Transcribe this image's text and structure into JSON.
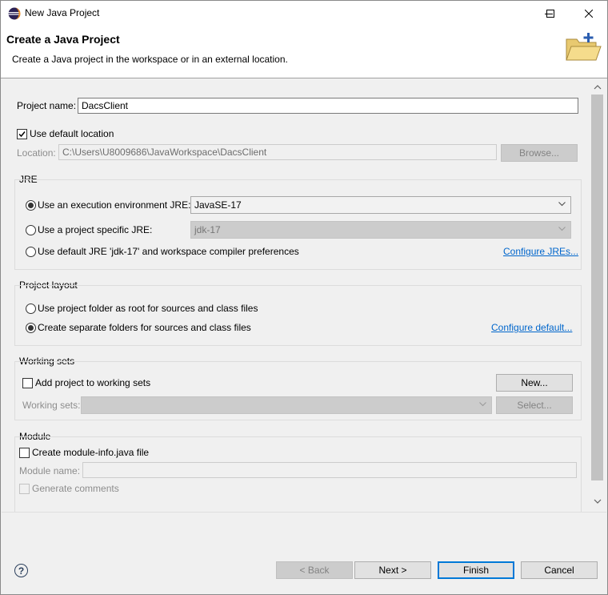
{
  "window": {
    "title": "New Java Project"
  },
  "header": {
    "title": "Create a Java Project",
    "description": "Create a Java project in the workspace or in an external location."
  },
  "project": {
    "name_label": "Project name:",
    "name_value": "DacsClient"
  },
  "location": {
    "use_default_label": "Use default location",
    "use_default_checked": true,
    "location_label": "Location:",
    "location_value": "C:\\Users\\U8009686\\JavaWorkspace\\DacsClient",
    "browse_label": "Browse..."
  },
  "jre": {
    "group_label": "JRE",
    "exec_env_label": "Use an execution environment JRE:",
    "exec_env_value": "JavaSE-17",
    "project_specific_label": "Use a project specific JRE:",
    "project_specific_value": "jdk-17",
    "default_jre_label": "Use default JRE 'jdk-17' and workspace compiler preferences",
    "configure_link": "Configure JREs...",
    "selected": "exec_env"
  },
  "layout": {
    "group_label": "Project layout",
    "option_root": "Use project folder as root for sources and class files",
    "option_separate": "Create separate folders for sources and class files",
    "configure_link": "Configure default...",
    "selected": "separate"
  },
  "working_sets": {
    "group_label": "Working sets",
    "add_label": "Add project to working sets",
    "new_label": "New...",
    "sets_label": "Working sets:",
    "select_label": "Select..."
  },
  "module": {
    "group_label": "Module",
    "create_label": "Create module-info.java file",
    "name_label": "Module name:",
    "comments_label": "Generate comments"
  },
  "footer": {
    "help_glyph": "?",
    "back_label": "< Back",
    "next_label": "Next >",
    "finish_label": "Finish",
    "cancel_label": "Cancel"
  },
  "colors": {
    "accent": "#0078d7",
    "link": "#0066cc",
    "header_bg": "#ffffff",
    "body_bg": "#f0f0f0"
  },
  "icons": [
    "eclipse-app-icon",
    "minimize-icon",
    "maximize-icon",
    "close-icon",
    "new-project-folder-icon",
    "help-icon",
    "chevron-down-icon",
    "scroll-up-icon",
    "scroll-down-icon"
  ]
}
